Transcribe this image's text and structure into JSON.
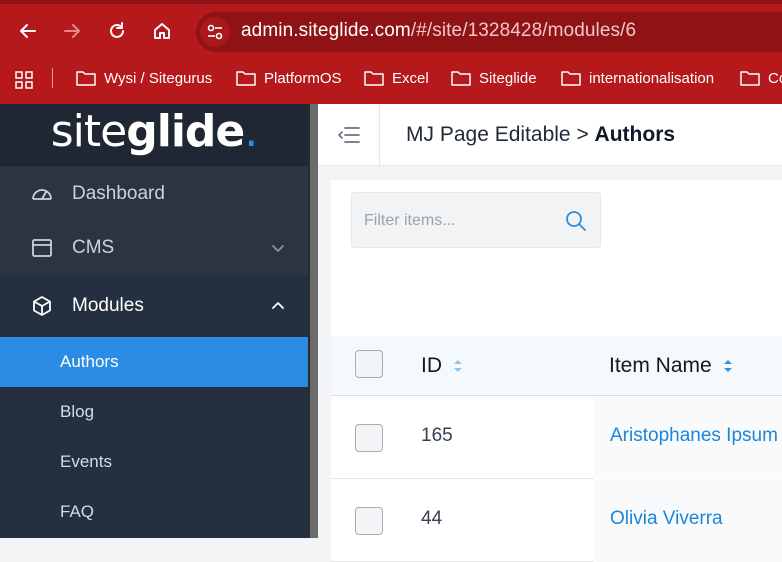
{
  "browser": {
    "url_host": "admin.siteglide.com",
    "url_path": "/#/site/1328428/modules/6",
    "bookmarks": [
      "Wysi / Sitegurus",
      "PlatformOS",
      "Excel",
      "Siteglide",
      "internationalisation",
      "Co"
    ]
  },
  "sidebar": {
    "logo_light": "site",
    "logo_bold": "glide",
    "logo_dot": ".",
    "items": [
      {
        "label": "Dashboard",
        "icon": "dashboard-gauge-icon"
      },
      {
        "label": "CMS",
        "icon": "window-icon"
      },
      {
        "label": "Modules",
        "icon": "cube-icon"
      }
    ],
    "module_items": [
      "Authors",
      "Blog",
      "Events",
      "FAQ"
    ],
    "active_module": "Authors"
  },
  "header": {
    "crumb_parent": "MJ Page Editable",
    "crumb_sep": " > ",
    "crumb_current": "Authors"
  },
  "filter": {
    "placeholder": "Filter items..."
  },
  "table": {
    "columns": [
      "ID",
      "Item Name"
    ],
    "rows": [
      {
        "id": "165",
        "name": "Aristophanes Ipsum"
      },
      {
        "id": "44",
        "name": "Olivia Viverra"
      }
    ]
  },
  "colors": {
    "browser_red": "#b5191c",
    "sidebar_bg": "#2b3542",
    "active_blue": "#2a8de3",
    "link_blue": "#1b86db"
  }
}
